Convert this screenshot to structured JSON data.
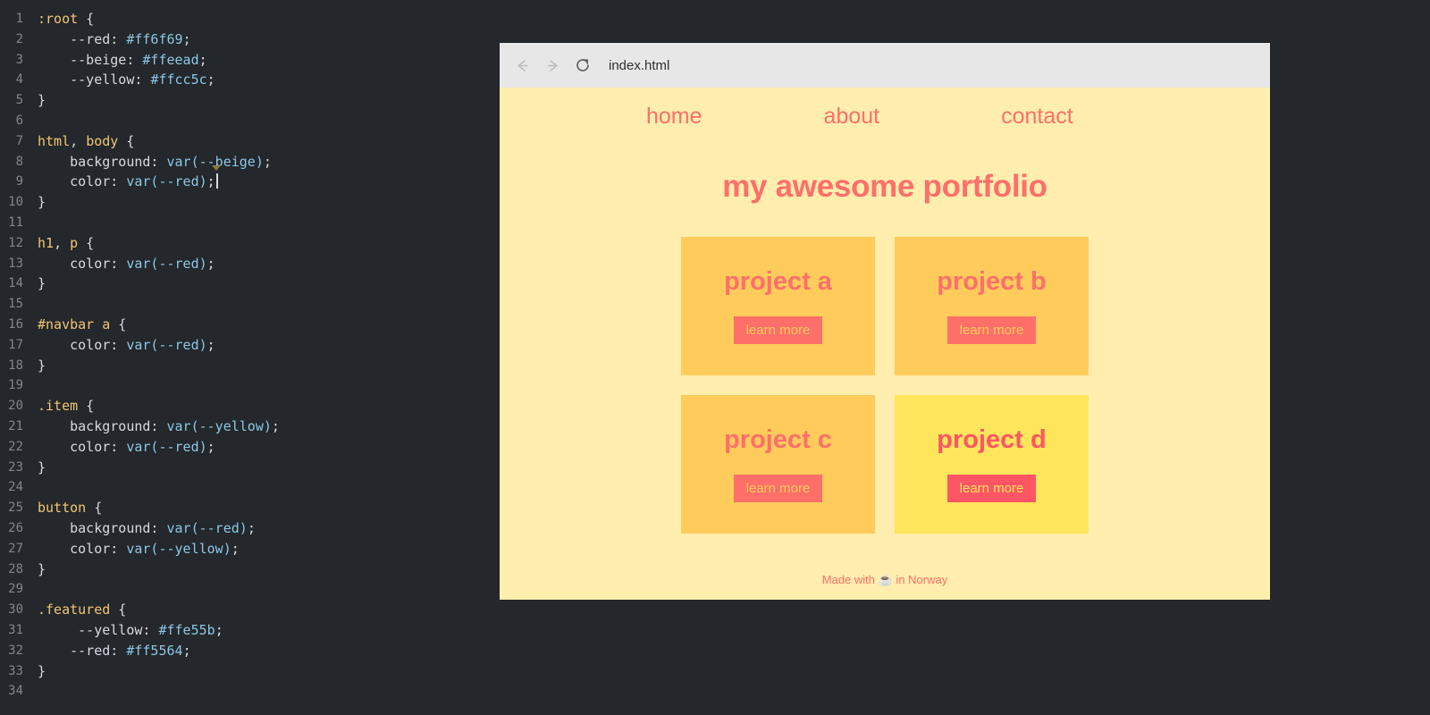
{
  "editor": {
    "language": "css",
    "colors": {
      "background": "#24272b",
      "selector": "#f0c674",
      "value": "#8cc7e6",
      "text": "#d5dae2",
      "line_number": "#7f868e"
    },
    "lines": [
      {
        "n": "1",
        "segments": [
          {
            "t": "sel",
            "v": ":root"
          },
          {
            "t": "punc",
            "v": " {"
          }
        ]
      },
      {
        "n": "2",
        "segments": [
          {
            "t": "prop",
            "v": "    --red: "
          },
          {
            "t": "val",
            "v": "#ff6f69"
          },
          {
            "t": "punc",
            "v": ";"
          }
        ]
      },
      {
        "n": "3",
        "segments": [
          {
            "t": "prop",
            "v": "    --beige: "
          },
          {
            "t": "val",
            "v": "#ffeead"
          },
          {
            "t": "punc",
            "v": ";"
          }
        ]
      },
      {
        "n": "4",
        "segments": [
          {
            "t": "prop",
            "v": "    --yellow: "
          },
          {
            "t": "val",
            "v": "#ffcc5c"
          },
          {
            "t": "punc",
            "v": ";"
          }
        ]
      },
      {
        "n": "5",
        "segments": [
          {
            "t": "punc",
            "v": "}"
          }
        ]
      },
      {
        "n": "6",
        "segments": []
      },
      {
        "n": "7",
        "segments": [
          {
            "t": "sel",
            "v": "html"
          },
          {
            "t": "punc",
            "v": ", "
          },
          {
            "t": "sel",
            "v": "body"
          },
          {
            "t": "punc",
            "v": " {"
          }
        ]
      },
      {
        "n": "8",
        "segments": [
          {
            "t": "prop",
            "v": "    background: "
          },
          {
            "t": "val",
            "v": "var(--beige)"
          },
          {
            "t": "punc",
            "v": ";"
          }
        ]
      },
      {
        "n": "9",
        "segments": [
          {
            "t": "prop",
            "v": "    color: "
          },
          {
            "t": "val",
            "v": "var(--red)"
          },
          {
            "t": "punc",
            "v": ";"
          }
        ],
        "caret": true
      },
      {
        "n": "10",
        "segments": [
          {
            "t": "punc",
            "v": "}"
          }
        ]
      },
      {
        "n": "11",
        "segments": []
      },
      {
        "n": "12",
        "segments": [
          {
            "t": "sel",
            "v": "h1"
          },
          {
            "t": "punc",
            "v": ", "
          },
          {
            "t": "sel",
            "v": "p"
          },
          {
            "t": "punc",
            "v": " {"
          }
        ]
      },
      {
        "n": "13",
        "segments": [
          {
            "t": "prop",
            "v": "    color: "
          },
          {
            "t": "val",
            "v": "var(--red)"
          },
          {
            "t": "punc",
            "v": ";"
          }
        ]
      },
      {
        "n": "14",
        "segments": [
          {
            "t": "punc",
            "v": "}"
          }
        ]
      },
      {
        "n": "15",
        "segments": []
      },
      {
        "n": "16",
        "segments": [
          {
            "t": "sel",
            "v": "#navbar"
          },
          {
            "t": "punc",
            "v": " "
          },
          {
            "t": "sel",
            "v": "a"
          },
          {
            "t": "punc",
            "v": " {"
          }
        ]
      },
      {
        "n": "17",
        "segments": [
          {
            "t": "prop",
            "v": "    color: "
          },
          {
            "t": "val",
            "v": "var(--red)"
          },
          {
            "t": "punc",
            "v": ";"
          }
        ]
      },
      {
        "n": "18",
        "segments": [
          {
            "t": "punc",
            "v": "}"
          }
        ]
      },
      {
        "n": "19",
        "segments": []
      },
      {
        "n": "20",
        "segments": [
          {
            "t": "sel",
            "v": ".item"
          },
          {
            "t": "punc",
            "v": " {"
          }
        ]
      },
      {
        "n": "21",
        "segments": [
          {
            "t": "prop",
            "v": "    background: "
          },
          {
            "t": "val",
            "v": "var(--yellow)"
          },
          {
            "t": "punc",
            "v": ";"
          }
        ]
      },
      {
        "n": "22",
        "segments": [
          {
            "t": "prop",
            "v": "    color: "
          },
          {
            "t": "val",
            "v": "var(--red)"
          },
          {
            "t": "punc",
            "v": ";"
          }
        ]
      },
      {
        "n": "23",
        "segments": [
          {
            "t": "punc",
            "v": "}"
          }
        ]
      },
      {
        "n": "24",
        "segments": []
      },
      {
        "n": "25",
        "segments": [
          {
            "t": "sel",
            "v": "button"
          },
          {
            "t": "punc",
            "v": " {"
          }
        ]
      },
      {
        "n": "26",
        "segments": [
          {
            "t": "prop",
            "v": "    background: "
          },
          {
            "t": "val",
            "v": "var(--red)"
          },
          {
            "t": "punc",
            "v": ";"
          }
        ]
      },
      {
        "n": "27",
        "segments": [
          {
            "t": "prop",
            "v": "    color: "
          },
          {
            "t": "val",
            "v": "var(--yellow)"
          },
          {
            "t": "punc",
            "v": ";"
          }
        ]
      },
      {
        "n": "28",
        "segments": [
          {
            "t": "punc",
            "v": "}"
          }
        ]
      },
      {
        "n": "29",
        "segments": []
      },
      {
        "n": "30",
        "segments": [
          {
            "t": "sel",
            "v": ".featured"
          },
          {
            "t": "punc",
            "v": " {"
          }
        ]
      },
      {
        "n": "31",
        "segments": [
          {
            "t": "prop",
            "v": "     --yellow: "
          },
          {
            "t": "val",
            "v": "#ffe55b"
          },
          {
            "t": "punc",
            "v": ";"
          }
        ]
      },
      {
        "n": "32",
        "segments": [
          {
            "t": "prop",
            "v": "    --red: "
          },
          {
            "t": "val",
            "v": "#ff5564"
          },
          {
            "t": "punc",
            "v": ";"
          }
        ]
      },
      {
        "n": "33",
        "segments": [
          {
            "t": "punc",
            "v": "}"
          }
        ]
      },
      {
        "n": "34",
        "segments": []
      }
    ]
  },
  "browser": {
    "back_label": "back",
    "forward_label": "forward",
    "reload_label": "reload",
    "url": "index.html"
  },
  "site": {
    "nav": [
      {
        "label": "home"
      },
      {
        "label": "about"
      },
      {
        "label": "contact"
      }
    ],
    "headline": "my awesome portfolio",
    "projects": [
      {
        "title": "project a",
        "button": "learn more",
        "featured": false
      },
      {
        "title": "project b",
        "button": "learn more",
        "featured": false
      },
      {
        "title": "project c",
        "button": "learn more",
        "featured": false
      },
      {
        "title": "project d",
        "button": "learn more",
        "featured": true
      }
    ],
    "footer": "Made with ☕ in Norway",
    "colors": {
      "red": "#ff6f69",
      "beige": "#ffeead",
      "yellow": "#ffcc5c",
      "featured_yellow": "#ffe55b",
      "featured_red": "#ff5564"
    }
  }
}
